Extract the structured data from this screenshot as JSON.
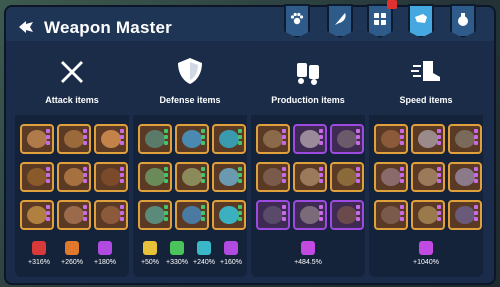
{
  "header": {
    "title": "Weapon Master"
  },
  "tabs": [
    {
      "name": "paw-tab",
      "icon": "paw-icon",
      "active": false
    },
    {
      "name": "feather-tab",
      "icon": "feather-icon",
      "active": false
    },
    {
      "name": "armor-tab",
      "icon": "armor-icon",
      "active": false,
      "notification": true
    },
    {
      "name": "weapon-tab",
      "icon": "hand-icon",
      "active": true
    },
    {
      "name": "potion-tab",
      "icon": "potion-icon",
      "active": false
    }
  ],
  "panels": [
    {
      "title": "Attack items",
      "icon": "swords-icon",
      "bonuses": [
        {
          "icon": "red-sword-icon",
          "color": "#d83a3a",
          "value": "+316%"
        },
        {
          "icon": "orange-axe-icon",
          "color": "#e0792c",
          "value": "+260%"
        },
        {
          "icon": "purple-bolt-icon",
          "color": "#b14ae0",
          "value": "+180%"
        }
      ]
    },
    {
      "title": "Defense items",
      "icon": "shield-icon",
      "bonuses": [
        {
          "icon": "yellow-crown-icon",
          "color": "#e6c23a",
          "value": "+50%"
        },
        {
          "icon": "green-leaf-icon",
          "color": "#4cc35a",
          "value": "+330%"
        },
        {
          "icon": "teal-shield-icon",
          "color": "#3ab8c8",
          "value": "+240%"
        },
        {
          "icon": "purple-bolt-icon",
          "color": "#b14ae0",
          "value": "+160%"
        }
      ]
    },
    {
      "title": "Production items",
      "icon": "gloves-icon",
      "bonuses": [
        {
          "icon": "purple-chest-icon",
          "color": "#c14ae0",
          "value": "+484.5%"
        }
      ]
    },
    {
      "title": "Speed items",
      "icon": "boot-icon",
      "bonuses": [
        {
          "icon": "purple-boot-icon",
          "color": "#c14ae0",
          "value": "+1040%"
        }
      ]
    }
  ],
  "colors": {
    "gold_border": "#e0a03c",
    "purple_border": "#9c4ae0",
    "active_tab": "#46a8e0"
  }
}
